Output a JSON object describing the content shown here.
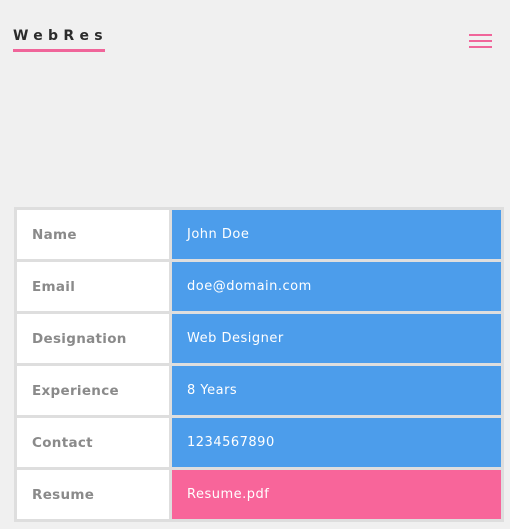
{
  "header": {
    "logo_text": "WebRes",
    "menu_icon": "hamburger-icon"
  },
  "colors": {
    "accent": "#f0659a",
    "value_bg": "#4c9deb",
    "link_bg": "#f8659a",
    "page_bg": "#f0f0f0"
  },
  "profile": {
    "rows": [
      {
        "label": "Name",
        "value": "John Doe"
      },
      {
        "label": "Email",
        "value": "doe@domain.com"
      },
      {
        "label": "Designation",
        "value": "Web Designer"
      },
      {
        "label": "Experience",
        "value": "8 Years"
      },
      {
        "label": "Contact",
        "value": "1234567890"
      },
      {
        "label": "Resume",
        "value": "Resume.pdf"
      }
    ]
  }
}
